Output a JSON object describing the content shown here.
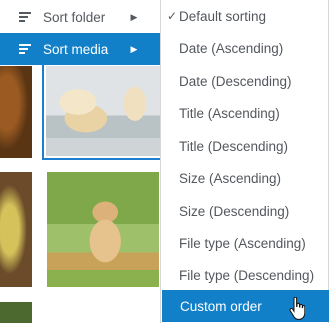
{
  "left_menu": {
    "sort_folder": {
      "label": "Sort folder",
      "icon": "sort-lines-icon",
      "chevron": "▶"
    },
    "sort_media": {
      "label": "Sort media",
      "icon": "sort-lines-icon",
      "chevron": "▶"
    }
  },
  "submenu": {
    "check_glyph": "✓",
    "items": [
      {
        "label": "Default sorting",
        "checked": true
      },
      {
        "label": "Date (Ascending)"
      },
      {
        "label": "Date (Descending)"
      },
      {
        "label": "Title (Ascending)"
      },
      {
        "label": "Title (Descending)"
      },
      {
        "label": "Size (Ascending)"
      },
      {
        "label": "Size (Descending)"
      },
      {
        "label": "File type (Ascending)"
      },
      {
        "label": "File type (Descending)"
      },
      {
        "label": "Custom order",
        "highlighted": true
      }
    ]
  },
  "colors": {
    "accent": "#1180c8",
    "text": "#53585e",
    "selection_border": "#1e7fd0"
  },
  "cursor": "hand-pointer-icon"
}
